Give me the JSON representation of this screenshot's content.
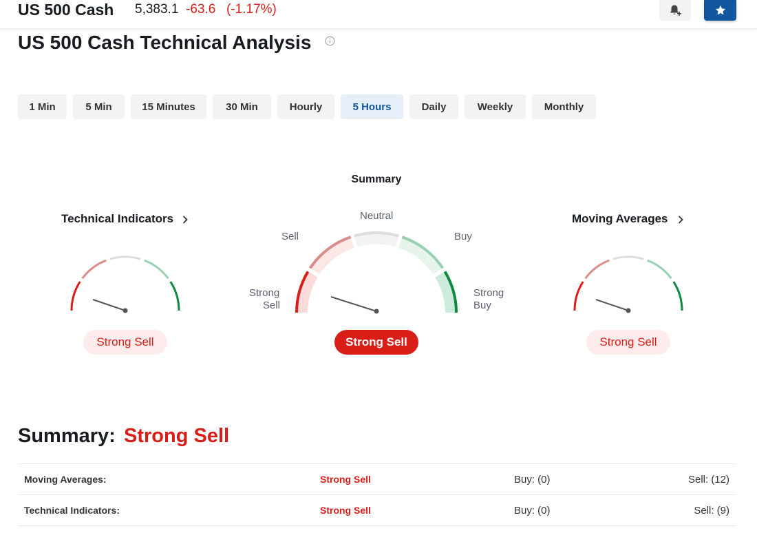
{
  "header": {
    "instrument_name": "US 500 Cash",
    "price": "5,383.1",
    "change": "-63.6",
    "change_pct": "(-1.17%)"
  },
  "page": {
    "title": "US 500 Cash Technical Analysis"
  },
  "timeframes": {
    "tabs": [
      "1 Min",
      "5 Min",
      "15 Minutes",
      "30 Min",
      "Hourly",
      "5 Hours",
      "Daily",
      "Weekly",
      "Monthly"
    ],
    "selected": "5 Hours"
  },
  "gauges": {
    "summary_label": "Summary",
    "technical_indicators": {
      "title": "Technical Indicators",
      "verdict": "Strong Sell"
    },
    "summary": {
      "verdict": "Strong Sell",
      "scale_labels": {
        "strong_sell_line1": "Strong",
        "strong_sell_line2": "Sell",
        "sell": "Sell",
        "neutral": "Neutral",
        "buy": "Buy",
        "strong_buy_line1": "Strong",
        "strong_buy_line2": "Buy"
      }
    },
    "moving_averages": {
      "title": "Moving Averages",
      "verdict": "Strong Sell"
    },
    "colors": {
      "strong_sell": "#d91e18",
      "sell": "#d98c89",
      "neutral": "#dddddd",
      "buy": "#98d1b1",
      "strong_buy": "#0d8a3e"
    }
  },
  "summary_table": {
    "heading": "Summary:",
    "verdict": "Strong Sell",
    "rows": [
      {
        "label": "Moving Averages:",
        "verdict": "Strong Sell",
        "buy": "Buy: (0)",
        "sell": "Sell: (12)"
      },
      {
        "label": "Technical Indicators:",
        "verdict": "Strong Sell",
        "buy": "Buy: (0)",
        "sell": "Sell: (9)"
      }
    ]
  },
  "icons": {
    "alert": "bell-plus-icon",
    "watchlist": "star-icon",
    "info": "info-circle-icon",
    "chevron": "chevron-right-icon"
  }
}
